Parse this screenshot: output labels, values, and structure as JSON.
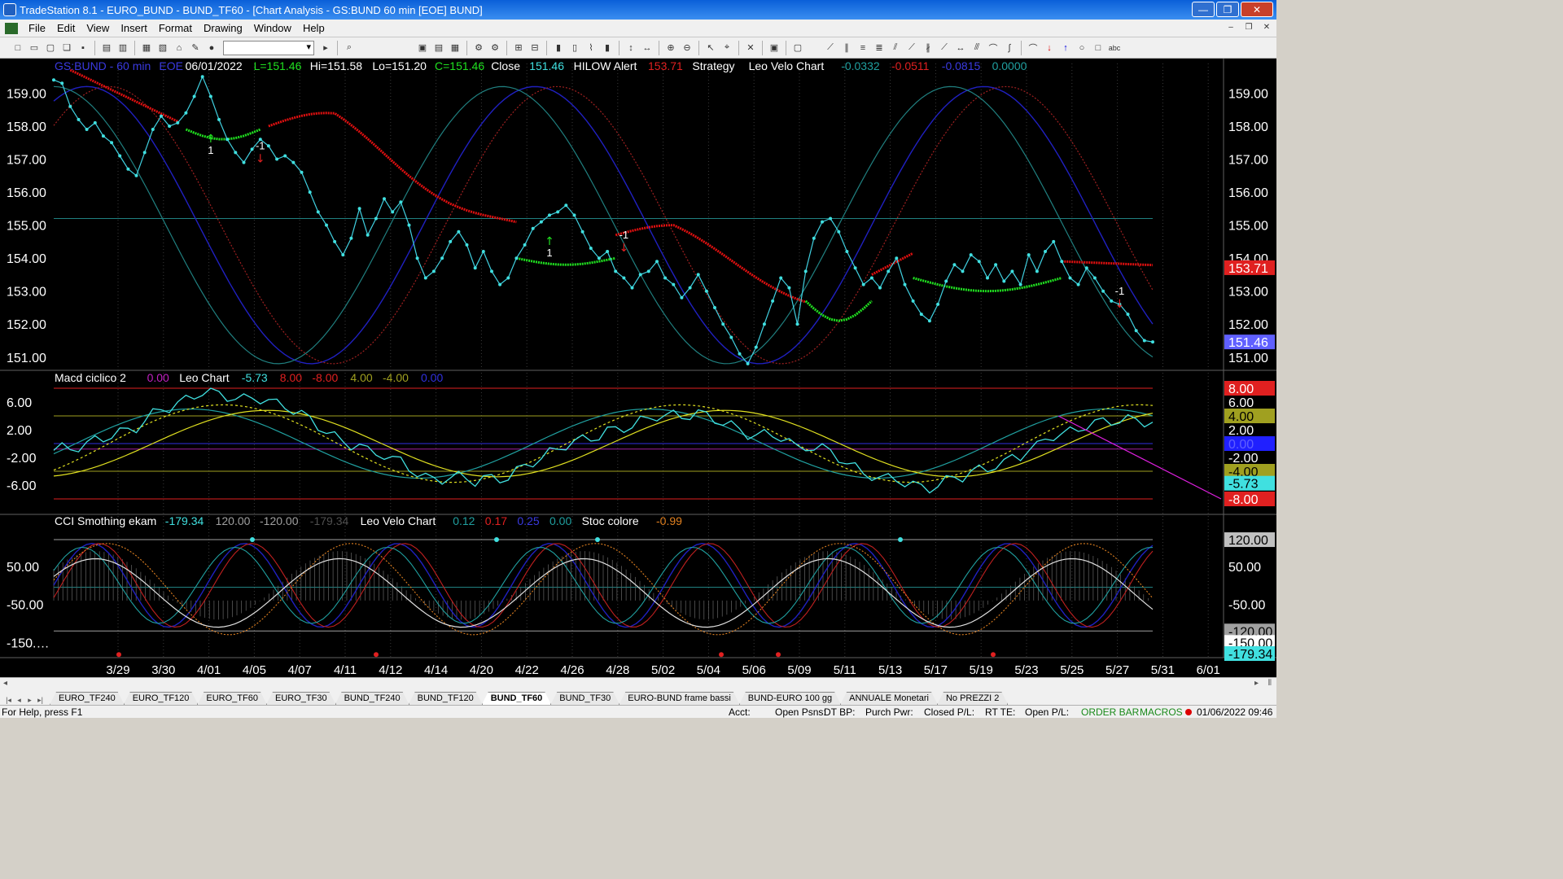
{
  "window": {
    "title": "TradeStation 8.1 - EURO_BUND - BUND_TF60 - [Chart Analysis - GS:BUND  60 min  [EOE] BUND]",
    "buttons": {
      "minimize": "—",
      "restore": "❐",
      "close": "✕"
    }
  },
  "menu": {
    "items": [
      "File",
      "Edit",
      "View",
      "Insert",
      "Format",
      "Drawing",
      "Window",
      "Help"
    ]
  },
  "toolbar": {
    "symbol_value": ""
  },
  "price_panel": {
    "header": [
      {
        "text": "GS:BUND - 60 min",
        "color": "#3a3ae0"
      },
      {
        "text": "EOE",
        "color": "#3a3ae0"
      },
      {
        "text": "06/01/2022",
        "color": "#ffffff"
      },
      {
        "text": "L=151.46",
        "color": "#20e020"
      },
      {
        "text": "Hi=151.58",
        "color": "#ffffff"
      },
      {
        "text": "Lo=151.20",
        "color": "#ffffff"
      },
      {
        "text": "C=151.46",
        "color": "#20e020"
      },
      {
        "text": "Close",
        "color": "#ffffff"
      },
      {
        "text": "151.46",
        "color": "#40e0e0"
      },
      {
        "text": "HILOW Alert",
        "color": "#ffffff"
      },
      {
        "text": "153.71",
        "color": "#e02020"
      },
      {
        "text": "Strategy",
        "color": "#ffffff"
      },
      {
        "text": "Leo Velo Chart",
        "color": "#ffffff"
      },
      {
        "text": "-0.0332",
        "color": "#20a0a0"
      },
      {
        "text": "-0.0511",
        "color": "#e02020"
      },
      {
        "text": "-0.0815",
        "color": "#3a3ae0"
      },
      {
        "text": "0.0000",
        "color": "#20a0a0"
      }
    ],
    "axis_ticks": [
      "159.00",
      "158.00",
      "157.00",
      "156.00",
      "155.00",
      "154.00",
      "153.00",
      "152.00",
      "151.00"
    ],
    "ylim": [
      150.6,
      159.8
    ],
    "markers": [
      {
        "text": "1",
        "arrow": "up",
        "x": 14,
        "y": 157.6
      },
      {
        "text": "-1",
        "arrow": "down",
        "x": 19,
        "y": 157.2
      },
      {
        "text": "1",
        "arrow": "up",
        "x": 45,
        "y": 154.5
      },
      {
        "text": "-1",
        "arrow": "down",
        "x": 52,
        "y": 154.5
      },
      {
        "text": "-1",
        "arrow": "down",
        "x": 97,
        "y": 152.8
      }
    ],
    "right_labels": [
      {
        "text": "153.71",
        "value": 153.71,
        "bg": "#e02020",
        "fg": "#ffffff"
      },
      {
        "text": "151.46",
        "value": 151.46,
        "bg": "#6060ff",
        "fg": "#ffffff"
      }
    ]
  },
  "macd_panel": {
    "header": [
      {
        "text": "Macd ciclico 2",
        "color": "#ffffff"
      },
      {
        "text": "0.00",
        "color": "#c020c0"
      },
      {
        "text": "Leo Chart",
        "color": "#ffffff"
      },
      {
        "text": "-5.73",
        "color": "#40e0e0"
      },
      {
        "text": "8.00",
        "color": "#e02020"
      },
      {
        "text": "-8.00",
        "color": "#e02020"
      },
      {
        "text": "4.00",
        "color": "#a0a020"
      },
      {
        "text": "-4.00",
        "color": "#a0a020"
      },
      {
        "text": "0.00",
        "color": "#3030e0"
      }
    ],
    "axis_ticks": [
      "6.00",
      "2.00",
      "-2.00",
      "-6.00"
    ],
    "ylim": [
      -10,
      10
    ],
    "right_labels": [
      {
        "text": "8.00",
        "value": 8,
        "bg": "#e02020",
        "fg": "#ffffff"
      },
      {
        "text": "4.00",
        "value": 4,
        "bg": "#a0a020",
        "fg": "#000000"
      },
      {
        "text": "0.00",
        "value": 0,
        "bg": "#2020ff",
        "fg": "#6060ff"
      },
      {
        "text": "-4.00",
        "value": -4,
        "bg": "#a0a020",
        "fg": "#000000"
      },
      {
        "text": "-5.73",
        "value": -5.73,
        "bg": "#40e0e0",
        "fg": "#000000"
      },
      {
        "text": "-8.00",
        "value": -8,
        "bg": "#e02020",
        "fg": "#ffffff"
      }
    ]
  },
  "cci_panel": {
    "header": [
      {
        "text": "CCI Smothing ekam",
        "color": "#ffffff"
      },
      {
        "text": "-179.34",
        "color": "#40e0e0"
      },
      {
        "text": "120.00",
        "color": "#a0a0a0"
      },
      {
        "text": "-120.00",
        "color": "#a0a0a0"
      },
      {
        "text": "-179.34",
        "color": "#505050"
      },
      {
        "text": "Leo Velo Chart",
        "color": "#ffffff"
      },
      {
        "text": "0.12",
        "color": "#20a0a0"
      },
      {
        "text": "0.17",
        "color": "#e02020"
      },
      {
        "text": "0.25",
        "color": "#3a3ae0"
      },
      {
        "text": "0.00",
        "color": "#20a0a0"
      },
      {
        "text": "Stoc colore",
        "color": "#ffffff"
      },
      {
        "text": "-0.99",
        "color": "#e08020"
      }
    ],
    "axis_ticks": [
      "50.00",
      "-50.00",
      "-150.…"
    ],
    "ylim": [
      -190,
      180
    ],
    "right_labels": [
      {
        "text": "120.00",
        "value": 120,
        "bg": "#c0c0c0",
        "fg": "#000000"
      },
      {
        "text": "-120.00",
        "value": -120,
        "bg": "#a0a0a0",
        "fg": "#000000"
      },
      {
        "text": "-150.00",
        "value": -150,
        "bg": "#ffffff",
        "fg": "#000000"
      },
      {
        "text": "-179.34",
        "value": -179.34,
        "bg": "#40e0e0",
        "fg": "#000000"
      }
    ]
  },
  "x_axis": {
    "labels": [
      "3/29",
      "3/30",
      "4/01",
      "4/05",
      "4/07",
      "4/11",
      "4/12",
      "4/14",
      "4/20",
      "4/22",
      "4/26",
      "4/28",
      "5/02",
      "5/04",
      "5/06",
      "5/09",
      "5/11",
      "5/13",
      "5/17",
      "5/19",
      "5/23",
      "5/25",
      "5/27",
      "5/31",
      "6/01"
    ]
  },
  "chart_data": {
    "type": "line",
    "x_count": 120,
    "close": [
      159.4,
      159.3,
      158.6,
      158.2,
      157.9,
      158.1,
      157.7,
      157.5,
      157.1,
      156.7,
      156.5,
      157.2,
      157.9,
      158.3,
      158.0,
      158.1,
      158.4,
      158.9,
      159.5,
      158.9,
      158.2,
      157.6,
      157.2,
      156.9,
      157.3,
      157.6,
      157.4,
      157.0,
      157.1,
      156.9,
      156.6,
      156.0,
      155.4,
      155.0,
      154.5,
      154.1,
      154.6,
      155.5,
      154.7,
      155.2,
      155.8,
      155.4,
      155.7,
      155.0,
      154.0,
      153.4,
      153.6,
      154.0,
      154.5,
      154.8,
      154.4,
      153.7,
      154.2,
      153.6,
      153.2,
      153.4,
      154.0,
      154.4,
      154.9,
      155.1,
      155.3,
      155.4,
      155.6,
      155.3,
      154.8,
      154.3,
      154.0,
      154.2,
      153.6,
      153.4,
      153.1,
      153.5,
      153.6,
      153.9,
      153.4,
      153.2,
      152.8,
      153.1,
      153.5,
      153.0,
      152.5,
      152.0,
      151.6,
      151.1,
      150.8,
      151.3,
      152.0,
      152.7,
      153.4,
      153.1,
      152.0,
      153.6,
      154.6,
      155.1,
      155.2,
      154.8,
      154.2,
      153.7,
      153.2,
      153.4,
      153.1,
      153.6,
      154.0,
      153.2,
      152.7,
      152.3,
      152.1,
      152.6,
      153.3,
      153.8,
      153.6,
      154.1,
      153.9,
      153.4,
      153.8,
      153.3,
      153.6,
      153.2,
      154.1,
      153.6,
      154.2,
      154.5,
      153.9,
      153.4,
      153.2,
      153.7,
      153.4,
      153.0,
      152.7,
      152.6,
      152.3,
      151.8,
      151.5,
      151.46
    ],
    "series_notes": "Price closes in cyan dotted line; HILOW Alert in red/green; velocity oscillators in blue, dark red dashed and teal lines"
  }
}
